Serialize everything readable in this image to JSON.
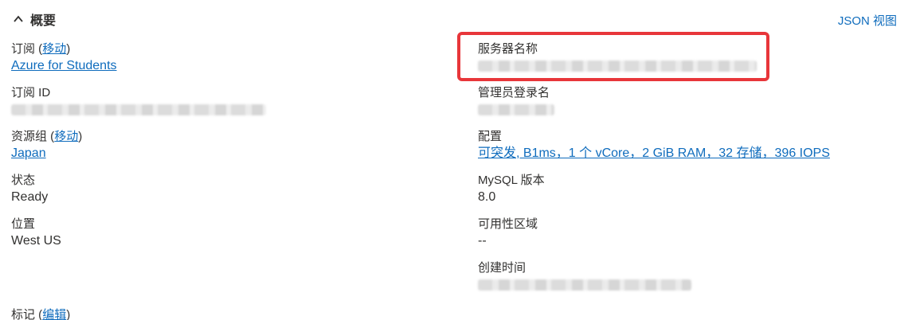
{
  "header": {
    "section_title": "概要",
    "json_view_label": "JSON 视图"
  },
  "left": {
    "subscription_label": "订阅",
    "subscription_move": "移动",
    "subscription_value": "Azure for Students",
    "subscription_id_label": "订阅 ID",
    "resource_group_label": "资源组",
    "resource_group_move": "移动",
    "resource_group_value": "Japan",
    "status_label": "状态",
    "status_value": "Ready",
    "location_label": "位置",
    "location_value": "West US",
    "tags_label": "标记",
    "tags_edit": "编辑"
  },
  "right": {
    "server_name_label": "服务器名称",
    "admin_login_label": "管理员登录名",
    "config_label": "配置",
    "config_value": "可突发, B1ms，1 个 vCore，2 GiB RAM，32 存储，396 IOPS",
    "mysql_version_label": "MySQL 版本",
    "mysql_version_value": "8.0",
    "availability_zone_label": "可用性区域",
    "availability_zone_value": "--",
    "created_time_label": "创建时间"
  },
  "icons": {
    "collapse": "chevron-up-icon"
  },
  "colors": {
    "link": "#0f6cbd",
    "text": "#323130",
    "highlight": "#e8363a"
  }
}
